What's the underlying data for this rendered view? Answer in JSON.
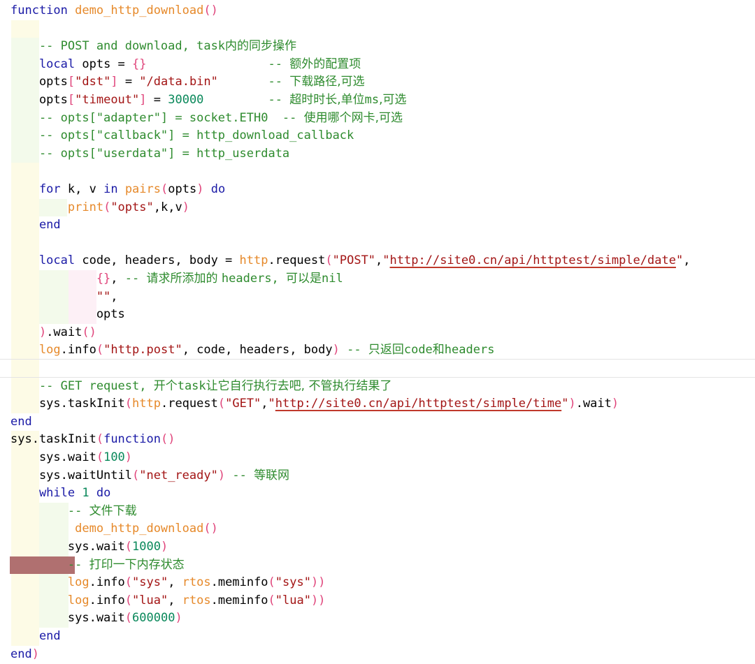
{
  "editor": {
    "language": "lua",
    "colors": {
      "background": "#ffffff",
      "keyword": "#1a1aa6",
      "function_name": "#e6892a",
      "string": "#a31515",
      "number": "#09885a",
      "comment": "#2e8b2e",
      "punctuation": "#e0457b",
      "identifier": "#000000",
      "url_underline": "#c0392b",
      "breakpoint_marker": "#b07070",
      "cursor_line": "#e4e4e4"
    },
    "breakpoint_line": 31,
    "cursor_line": 20,
    "lines": [
      [
        [
          "kw",
          "function"
        ],
        [
          "id",
          " "
        ],
        [
          "fn",
          "demo_http_download"
        ],
        [
          "pun",
          "()"
        ]
      ],
      [],
      [
        [
          "cm",
          "    -- POST and download, task"
        ],
        [
          "cjk",
          "内的同步操作"
        ]
      ],
      [
        [
          "kw",
          "    local"
        ],
        [
          "id",
          " opts = "
        ],
        [
          "pun",
          "{}"
        ],
        [
          "id",
          "                 "
        ],
        [
          "cm",
          "-- "
        ],
        [
          "cjk",
          "额外的配置项"
        ]
      ],
      [
        [
          "id",
          "    opts"
        ],
        [
          "pun",
          "["
        ],
        [
          "str",
          "\"dst\""
        ],
        [
          "pun",
          "]"
        ],
        [
          "id",
          " = "
        ],
        [
          "str",
          "\"/data.bin\""
        ],
        [
          "id",
          "       "
        ],
        [
          "cm",
          "-- "
        ],
        [
          "cjk",
          "下载路径,可选"
        ]
      ],
      [
        [
          "id",
          "    opts"
        ],
        [
          "pun",
          "["
        ],
        [
          "str",
          "\"timeout\""
        ],
        [
          "pun",
          "]"
        ],
        [
          "id",
          " = "
        ],
        [
          "num",
          "30000"
        ],
        [
          "id",
          "         "
        ],
        [
          "cm",
          "-- "
        ],
        [
          "cjk",
          "超时时长,单位"
        ],
        [
          "cm",
          "ms"
        ],
        [
          "cjk",
          ",可选"
        ]
      ],
      [
        [
          "cm",
          "    -- opts[\"adapter\"] = socket.ETH0  -- "
        ],
        [
          "cjk",
          "使用哪个网卡,可选"
        ]
      ],
      [
        [
          "cm",
          "    -- opts[\"callback\"] = http_download_callback"
        ]
      ],
      [
        [
          "cm",
          "    -- opts[\"userdata\"] = http_userdata"
        ]
      ],
      [],
      [
        [
          "kw",
          "    for"
        ],
        [
          "id",
          " k, v "
        ],
        [
          "kw",
          "in"
        ],
        [
          "id",
          " "
        ],
        [
          "fn",
          "pairs"
        ],
        [
          "pun",
          "("
        ],
        [
          "id",
          "opts"
        ],
        [
          "pun",
          ")"
        ],
        [
          "id",
          " "
        ],
        [
          "kw",
          "do"
        ]
      ],
      [
        [
          "fn",
          "        print"
        ],
        [
          "pun",
          "("
        ],
        [
          "str",
          "\"opts\""
        ],
        [
          "id",
          ",k,v"
        ],
        [
          "pun",
          ")"
        ]
      ],
      [
        [
          "kw",
          "    end"
        ]
      ],
      [],
      [
        [
          "kw",
          "    local"
        ],
        [
          "id",
          " code, headers, body = "
        ],
        [
          "fn",
          "http"
        ],
        [
          "id",
          ".request"
        ],
        [
          "pun",
          "("
        ],
        [
          "str",
          "\"POST\""
        ],
        [
          "id",
          ","
        ],
        [
          "str",
          "\""
        ],
        [
          "url",
          "http://site0.cn/api/httptest/simple/date"
        ],
        [
          "str",
          "\""
        ],
        [
          "id",
          ","
        ]
      ],
      [
        [
          "pun",
          "            {}"
        ],
        [
          "id",
          ", "
        ],
        [
          "cm",
          "-- "
        ],
        [
          "cjk",
          "请求所添加的 "
        ],
        [
          "cm",
          "headers, "
        ],
        [
          "cjk",
          "可以是"
        ],
        [
          "cm",
          "nil"
        ]
      ],
      [
        [
          "str",
          "            \"\""
        ],
        [
          "id",
          ","
        ]
      ],
      [
        [
          "id",
          "            opts"
        ]
      ],
      [
        [
          "pun",
          "    )"
        ],
        [
          "id",
          ".wait"
        ],
        [
          "pun",
          "()"
        ]
      ],
      [
        [
          "fn",
          "    log"
        ],
        [
          "id",
          ".info"
        ],
        [
          "pun",
          "("
        ],
        [
          "str",
          "\"http.post\""
        ],
        [
          "id",
          ", code, headers, body"
        ],
        [
          "pun",
          ")"
        ],
        [
          "id",
          " "
        ],
        [
          "cm",
          "-- "
        ],
        [
          "cjk",
          "只返回"
        ],
        [
          "cm",
          "code"
        ],
        [
          "cjk",
          "和"
        ],
        [
          "cm",
          "headers"
        ]
      ],
      [],
      [
        [
          "cm",
          "    -- GET request, "
        ],
        [
          "cjk",
          "开个"
        ],
        [
          "cm",
          "task"
        ],
        [
          "cjk",
          "让它自行执行去吧, 不管执行结果了"
        ]
      ],
      [
        [
          "id",
          "    sys.taskInit"
        ],
        [
          "pun",
          "("
        ],
        [
          "fn",
          "http"
        ],
        [
          "id",
          ".request"
        ],
        [
          "pun",
          "("
        ],
        [
          "str",
          "\"GET\""
        ],
        [
          "id",
          ","
        ],
        [
          "str",
          "\""
        ],
        [
          "url",
          "http://site0.cn/api/httptest/simple/time"
        ],
        [
          "str",
          "\""
        ],
        [
          "pun",
          ")"
        ],
        [
          "id",
          ".wait"
        ],
        [
          "pun",
          ")"
        ]
      ],
      [
        [
          "kw",
          "end"
        ]
      ],
      [
        [
          "id",
          "sys.taskInit"
        ],
        [
          "pun",
          "("
        ],
        [
          "kw",
          "function"
        ],
        [
          "pun",
          "()"
        ]
      ],
      [
        [
          "id",
          "    sys.wait"
        ],
        [
          "pun",
          "("
        ],
        [
          "num",
          "100"
        ],
        [
          "pun",
          ")"
        ]
      ],
      [
        [
          "id",
          "    sys.waitUntil"
        ],
        [
          "pun",
          "("
        ],
        [
          "str",
          "\"net_ready\""
        ],
        [
          "pun",
          ")"
        ],
        [
          "id",
          " "
        ],
        [
          "cm",
          "-- "
        ],
        [
          "cjk",
          "等联网"
        ]
      ],
      [
        [
          "kw",
          "    while"
        ],
        [
          "id",
          " "
        ],
        [
          "num",
          "1"
        ],
        [
          "id",
          " "
        ],
        [
          "kw",
          "do"
        ]
      ],
      [
        [
          "cm",
          "        -- "
        ],
        [
          "cjk",
          "文件下载"
        ]
      ],
      [
        [
          "fn",
          "         demo_http_download"
        ],
        [
          "pun",
          "()"
        ]
      ],
      [
        [
          "id",
          "        sys.wait"
        ],
        [
          "pun",
          "("
        ],
        [
          "num",
          "1000"
        ],
        [
          "pun",
          ")"
        ]
      ],
      [
        [
          "cm",
          "        -- "
        ],
        [
          "cjk",
          "打印一下内存状态"
        ]
      ],
      [
        [
          "fn",
          "        log"
        ],
        [
          "id",
          ".info"
        ],
        [
          "pun",
          "("
        ],
        [
          "str",
          "\"sys\""
        ],
        [
          "id",
          ", "
        ],
        [
          "fn",
          "rtos"
        ],
        [
          "id",
          ".meminfo"
        ],
        [
          "pun",
          "("
        ],
        [
          "str",
          "\"sys\""
        ],
        [
          "pun",
          "))"
        ]
      ],
      [
        [
          "fn",
          "        log"
        ],
        [
          "id",
          ".info"
        ],
        [
          "pun",
          "("
        ],
        [
          "str",
          "\"lua\""
        ],
        [
          "id",
          ", "
        ],
        [
          "fn",
          "rtos"
        ],
        [
          "id",
          ".meminfo"
        ],
        [
          "pun",
          "("
        ],
        [
          "str",
          "\"lua\""
        ],
        [
          "pun",
          "))"
        ]
      ],
      [
        [
          "id",
          "        sys.wait"
        ],
        [
          "pun",
          "("
        ],
        [
          "num",
          "600000"
        ],
        [
          "pun",
          ")"
        ]
      ],
      [
        [
          "kw",
          "    end"
        ]
      ],
      [
        [
          "kw",
          "end"
        ],
        [
          "pun",
          ")"
        ]
      ]
    ]
  }
}
